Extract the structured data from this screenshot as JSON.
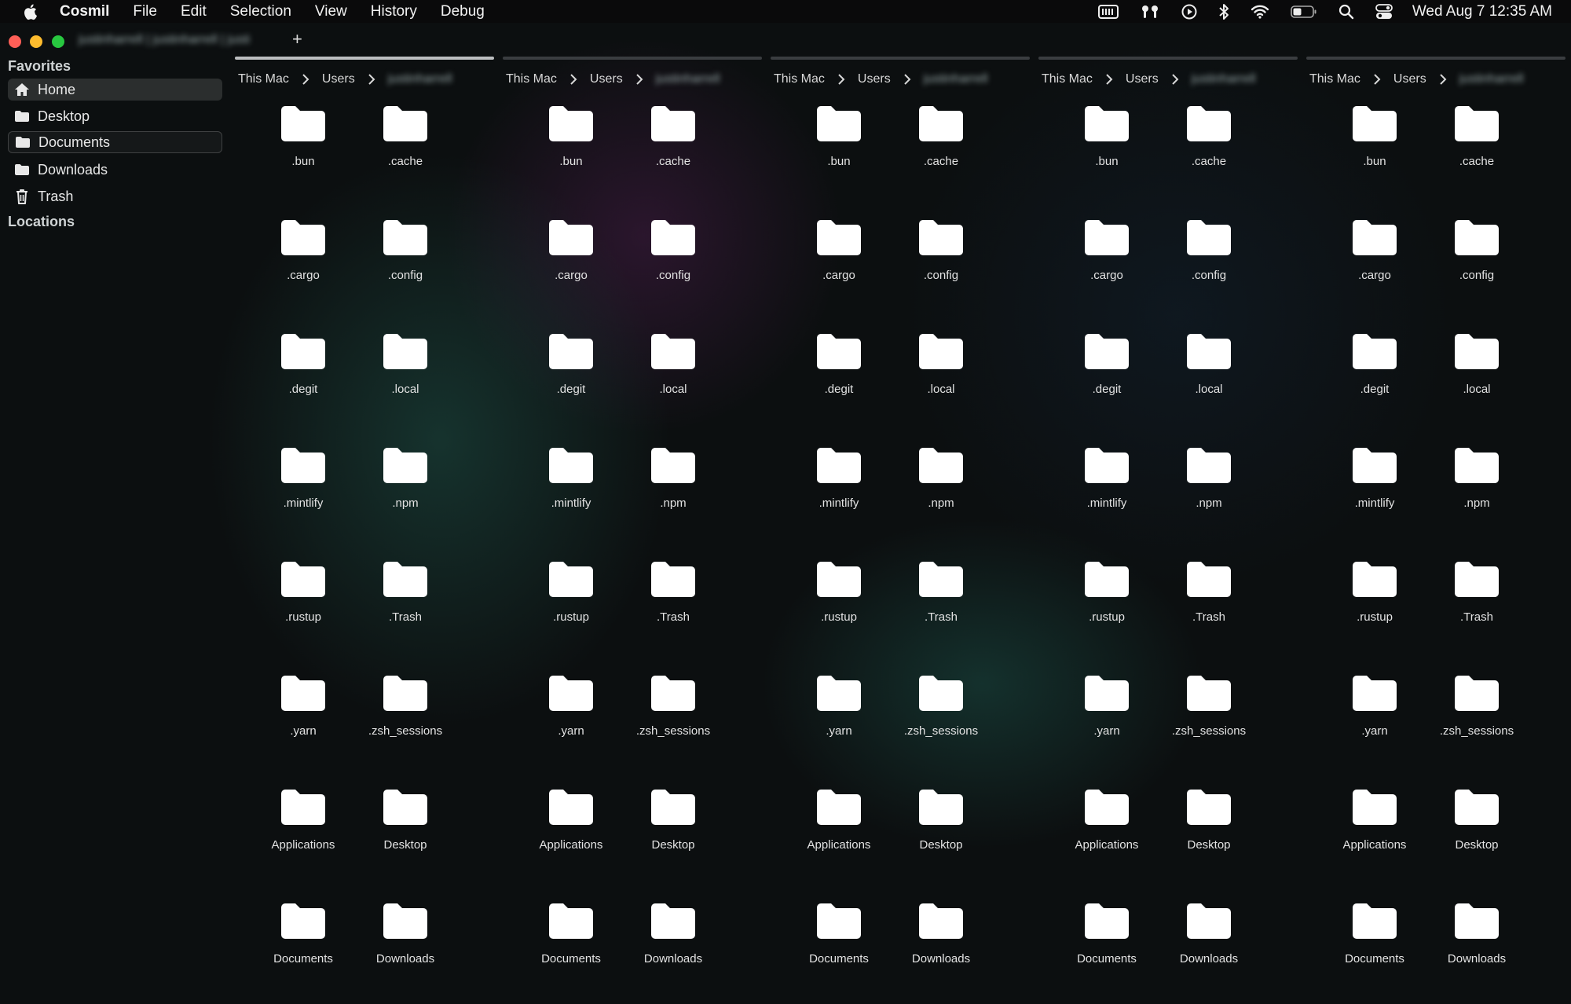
{
  "menubar": {
    "app_name": "Cosmil",
    "menus": [
      "File",
      "Edit",
      "Selection",
      "View",
      "History",
      "Debug"
    ],
    "status_icons": [
      "keyboard-icon",
      "airpods-icon",
      "play-icon",
      "bluetooth-icon",
      "wifi-icon",
      "battery-icon",
      "search-icon",
      "control-center-icon"
    ],
    "clock": "Wed Aug 7  12:35 AM"
  },
  "tabbar": {
    "tab_title": "justinharrell | justinharrell | justi",
    "new_tab_label": "+"
  },
  "sidebar": {
    "favorites_title": "Favorites",
    "items": [
      {
        "label": "Home",
        "icon": "home-icon"
      },
      {
        "label": "Desktop",
        "icon": "folder-icon"
      },
      {
        "label": "Documents",
        "icon": "folder-icon"
      },
      {
        "label": "Downloads",
        "icon": "folder-icon"
      },
      {
        "label": "Trash",
        "icon": "trash-icon"
      }
    ],
    "locations_title": "Locations"
  },
  "panes": [
    {
      "breadcrumb": [
        "This Mac",
        "Users",
        "justinharrell"
      ]
    },
    {
      "breadcrumb": [
        "This Mac",
        "Users",
        "justinharrell"
      ]
    },
    {
      "breadcrumb": [
        "This Mac",
        "Users",
        "justinharrell"
      ]
    },
    {
      "breadcrumb": [
        "This Mac",
        "Users",
        "justinharrell"
      ]
    },
    {
      "breadcrumb": [
        "This Mac",
        "Users",
        "justinharrell"
      ]
    }
  ],
  "folders": [
    ".bun",
    ".cache",
    ".cargo",
    ".config",
    ".degit",
    ".local",
    ".mintlify",
    ".npm",
    ".rustup",
    ".Trash",
    ".yarn",
    ".zsh_sessions",
    "Applications",
    "Desktop",
    "Documents",
    "Downloads"
  ],
  "colors": {
    "close": "#fe5f57",
    "minimize": "#febc2e",
    "maximize": "#28c840",
    "folder": "#ffffff"
  }
}
